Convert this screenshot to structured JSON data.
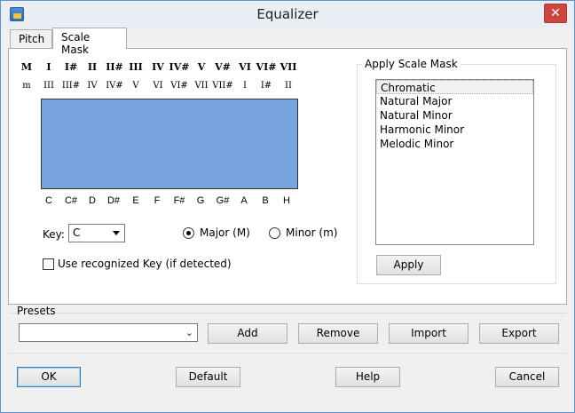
{
  "window": {
    "title": "Equalizer",
    "close_glyph": "✕",
    "icon": "app-icon"
  },
  "tabs": [
    {
      "label": "Pitch"
    },
    {
      "label": "Scale Mask",
      "active": true
    }
  ],
  "scale_mask": {
    "major_degrees": [
      "M",
      "I",
      "I#",
      "II",
      "II#",
      "III",
      "IV",
      "IV#",
      "V",
      "V#",
      "VI",
      "VI#",
      "VII"
    ],
    "minor_degrees": [
      "m",
      "III",
      "III#",
      "IV",
      "IV#",
      "V",
      "VI",
      "VI#",
      "VII",
      "VII#",
      "I",
      "I#",
      "II"
    ],
    "notes": [
      "C",
      "C#",
      "D",
      "D#",
      "E",
      "F",
      "F#",
      "G",
      "G#",
      "A",
      "B",
      "H"
    ],
    "canvas_color": "#78a4dd"
  },
  "key": {
    "label": "Key:",
    "value": "C"
  },
  "mode": {
    "major_label": "Major (M)",
    "minor_label": "Minor (m)",
    "selected": "major"
  },
  "use_recognized_key": {
    "label": "Use recognized Key (if detected)",
    "checked": false
  },
  "apply_group": {
    "title": "Apply Scale Mask",
    "items": [
      "Chromatic",
      "Natural Major",
      "Natural Minor",
      "Harmonic Minor",
      "Melodic Minor"
    ],
    "selected_index": 0,
    "apply_label": "Apply"
  },
  "presets": {
    "label": "Presets",
    "value": "",
    "buttons": {
      "add": "Add",
      "remove": "Remove",
      "import": "Import",
      "export": "Export"
    }
  },
  "footer": {
    "ok": "OK",
    "default": "Default",
    "help": "Help",
    "cancel": "Cancel"
  }
}
